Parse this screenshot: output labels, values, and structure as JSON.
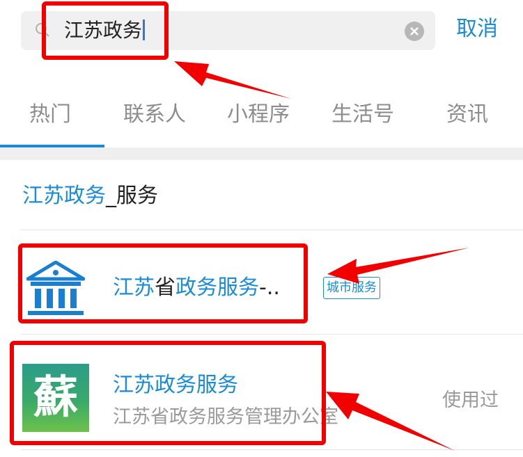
{
  "search": {
    "query": "江苏政务",
    "cancel_label": "取消",
    "icons": {
      "search": "search-icon",
      "clear": "clear-icon"
    }
  },
  "tabs": [
    {
      "label": "热门",
      "active": true
    },
    {
      "label": "联系人",
      "active": false
    },
    {
      "label": "小程序",
      "active": false
    },
    {
      "label": "生活号",
      "active": false
    },
    {
      "label": "资讯",
      "active": false
    }
  ],
  "suggestion": {
    "highlight": "江苏政务",
    "rest": "_服务"
  },
  "results": [
    {
      "title_parts": [
        "江苏",
        "省",
        "政务服务",
        "-.."
      ],
      "badge": "城市服务",
      "icon": "government-building-icon"
    },
    {
      "title": "江苏政务服务",
      "subtitle": "江苏省政务服务管理办公室",
      "status": "使用过",
      "icon": "su-calligraphy-app-icon",
      "icon_glyph": "蘇"
    }
  ],
  "colors": {
    "accent": "#1a8bd6",
    "annotation_red": "#f20000",
    "search_bg": "#f0f0f0",
    "muted_text": "#9a9a9a"
  }
}
